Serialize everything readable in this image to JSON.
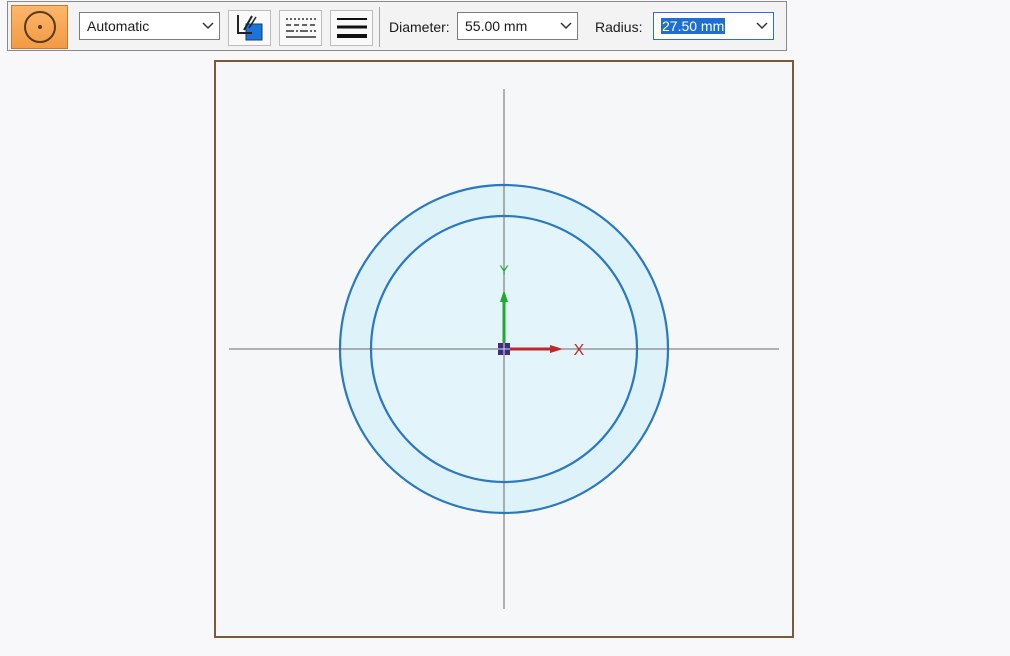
{
  "toolbar": {
    "tool_icon": "circle-center-icon",
    "mode_select": {
      "value": "Automatic"
    },
    "buttons": [
      {
        "name": "style-fill-button",
        "icon": "line-color-fill-icon"
      },
      {
        "name": "dash-style-button",
        "icon": "dashed-lines-icon"
      },
      {
        "name": "line-weight-button",
        "icon": "line-weight-icon"
      }
    ],
    "diameter": {
      "label": "Diameter:",
      "value": "55.00 mm"
    },
    "radius": {
      "label": "Radius:",
      "value": "27.50 mm"
    }
  },
  "sketch": {
    "axis_x_label": "X",
    "axis_y_label": "Y",
    "colors": {
      "circle_stroke": "#2a78c0",
      "circle_fill": "#ddf2f9",
      "frame": "#7a5a38",
      "x_axis": "#c0262a",
      "y_axis": "#1eaa2c"
    }
  }
}
